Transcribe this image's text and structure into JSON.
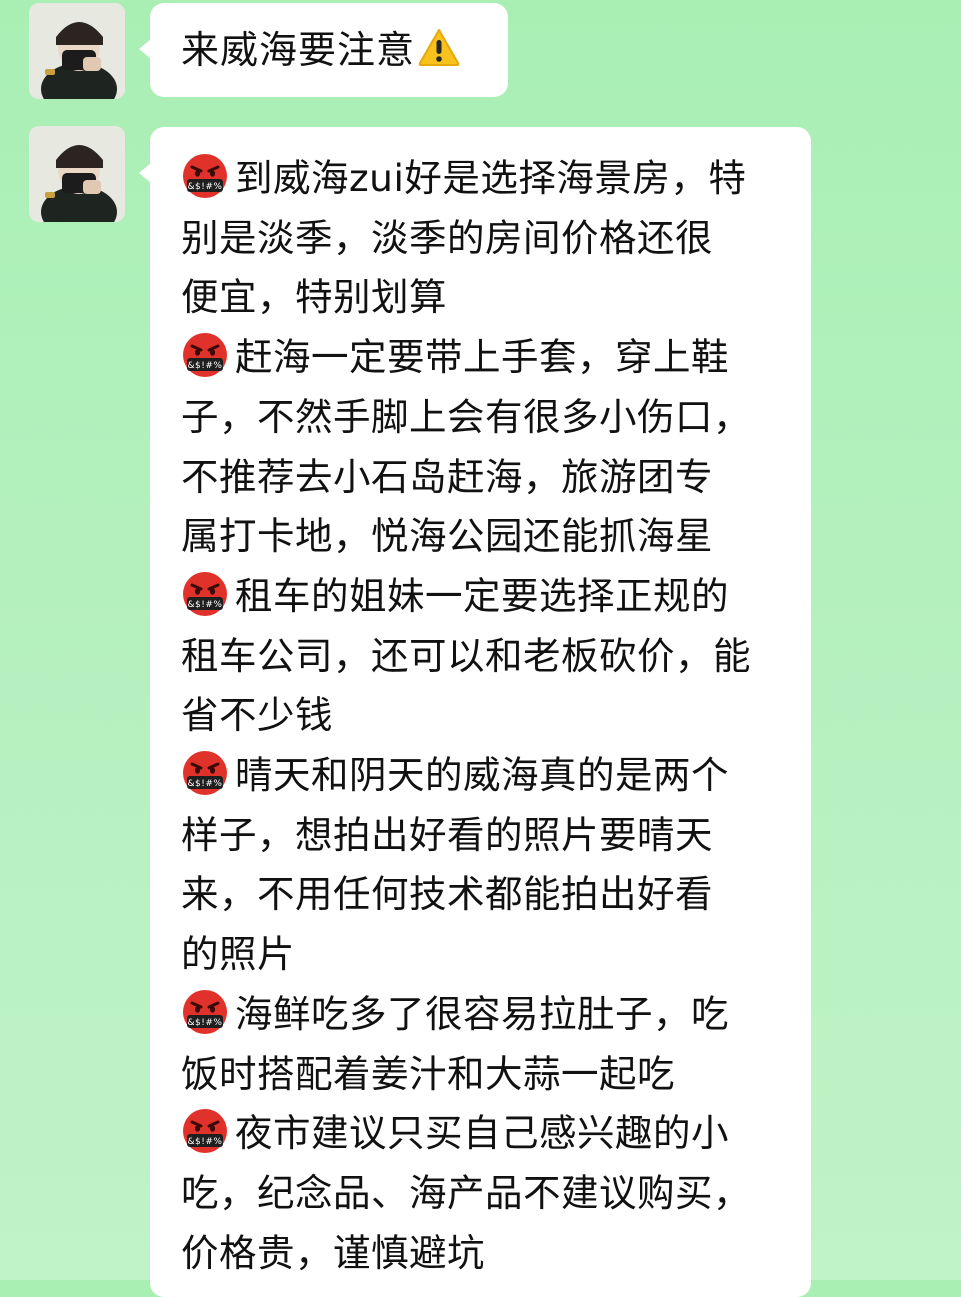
{
  "messages": [
    {
      "sender_avatar": "avatar-person-masked",
      "text": "来威海要注意",
      "trailing_icon": "warning-icon"
    },
    {
      "sender_avatar": "avatar-person-masked",
      "tip_icon": "angry-swearing-face-icon",
      "tips": [
        {
          "lines": [
            "到威海zui好是选择海景房，特",
            "别是淡季，淡季的房间价格还很",
            "便宜，特别划算"
          ]
        },
        {
          "lines": [
            "赶海一定要带上手套，穿上鞋",
            "子，不然手脚上会有很多小伤口，",
            "不推荐去小石岛赶海，旅游团专",
            "属打卡地，悦海公园还能抓海星"
          ]
        },
        {
          "lines": [
            "租车的姐妹一定要选择正规的",
            "租车公司，还可以和老板砍价，能",
            "省不少钱"
          ]
        },
        {
          "lines": [
            "晴天和阴天的威海真的是两个",
            "样子，想拍出好看的照片要晴天",
            "来，不用任何技术都能拍出好看",
            "的照片"
          ]
        },
        {
          "lines": [
            "海鲜吃多了很容易拉肚子，吃",
            "饭时搭配着姜汁和大蒜一起吃"
          ]
        },
        {
          "lines": [
            "夜市建议只买自己感兴趣的小",
            "吃，纪念品、海产品不建议购买，",
            "价格贵，谨慎避坑"
          ]
        }
      ]
    }
  ],
  "colors": {
    "chat_background": "#b4f0be",
    "bubble": "#ffffff",
    "angry_face": "#e0322a"
  },
  "angry_symbols": "&$!#%"
}
